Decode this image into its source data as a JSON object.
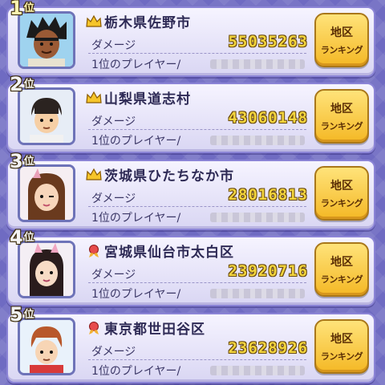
{
  "labels": {
    "damage": "ダメージ",
    "top_player": "1位のプレイヤー/",
    "button_line1": "地区",
    "button_line2": "ランキング",
    "rank_suffix": "位"
  },
  "entries": [
    {
      "rank": "1",
      "location": "栃木県佐野市",
      "damage": "55035263",
      "icon": "crown-icon"
    },
    {
      "rank": "2",
      "location": "山梨県道志村",
      "damage": "43060148",
      "icon": "crown-icon"
    },
    {
      "rank": "3",
      "location": "茨城県ひたちなか市",
      "damage": "28016813",
      "icon": "crown-icon"
    },
    {
      "rank": "4",
      "location": "宮城県仙台市太白区",
      "damage": "23920716",
      "icon": "ribbon-icon"
    },
    {
      "rank": "5",
      "location": "東京都世田谷区",
      "damage": "23628926",
      "icon": "ribbon-icon"
    }
  ],
  "colors": {
    "background": "#6f6bc2",
    "damage_text": "#f2d43c",
    "button": "#f4b825"
  }
}
